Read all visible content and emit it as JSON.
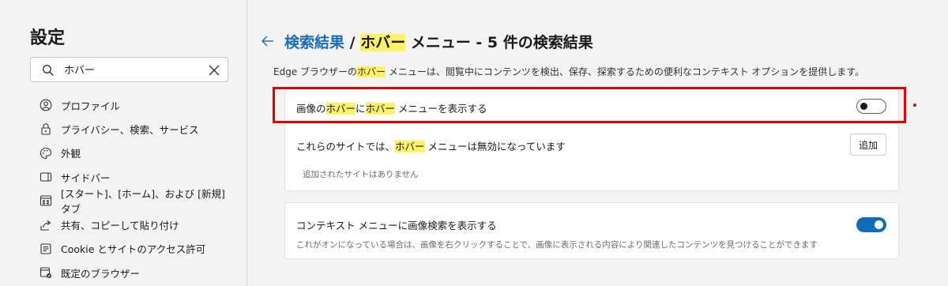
{
  "sidebar": {
    "title": "設定",
    "search": {
      "value": "ホバー",
      "placeholder": ""
    },
    "items": [
      {
        "label": "プロファイル",
        "icon": "profile-icon"
      },
      {
        "label": "プライバシー、検索、サービス",
        "icon": "lock-icon"
      },
      {
        "label": "外観",
        "icon": "palette-icon"
      },
      {
        "label": "サイドバー",
        "icon": "sidebar-icon"
      },
      {
        "label": "[スタート]、[ホーム]、および [新規] タブ",
        "icon": "home-tab-icon"
      },
      {
        "label": "共有、コピーして貼り付け",
        "icon": "share-icon"
      },
      {
        "label": "Cookie とサイトのアクセス許可",
        "icon": "cookie-icon"
      },
      {
        "label": "既定のブラウザー",
        "icon": "browser-icon"
      }
    ]
  },
  "header": {
    "link": "検索結果",
    "separator": " / ",
    "highlight": "ホバー",
    "rest": " メニュー - 5 件の検索結果"
  },
  "description": {
    "before": "Edge ブラウザーの",
    "highlight": "ホバー",
    "after": " メニューは、閲覧中にコンテンツを検出、保存、探索するための便利なコンテキスト オプションを提供します。"
  },
  "card1": {
    "row1": {
      "p1": "画像の",
      "h1": "ホバー",
      "p2": "に",
      "h2": "ホバー",
      "p3": " メニューを表示する",
      "toggle": "off"
    },
    "row2": {
      "p1": "これらのサイトでは、",
      "h1": "ホバー",
      "p2": " メニューは無効になっています",
      "button": "追加",
      "empty": "追加されたサイトはありません"
    }
  },
  "card2": {
    "label": "コンテキスト メニューに画像検索を表示する",
    "sub": "これがオンになっている場合は、画像を右クリックすることで、画像に表示される内容により関連したコンテンツを見つけることができます",
    "toggle": "on"
  },
  "colors": {
    "accent": "#0f6cbd",
    "highlight": "#fff266",
    "annotation": "#e00000",
    "link": "#1a6bb8"
  }
}
